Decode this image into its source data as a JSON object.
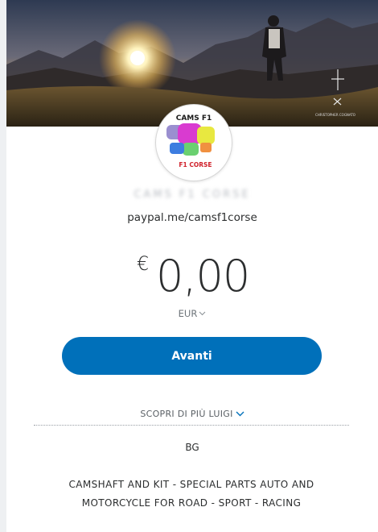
{
  "profile": {
    "logo_text_top": "CAMS F1",
    "logo_text_bottom": "F1 CORSE",
    "name": "CAMS F1 CORSE",
    "handle": "paypal.me/camsf1corse",
    "banner_credit": "CHRISTOPHER COGNATO"
  },
  "payment": {
    "currency_symbol": "€",
    "amount": "0,00",
    "currency_code": "EUR",
    "next_label": "Avanti"
  },
  "details": {
    "more_label": "SCOPRI DI PIÙ LUIGI",
    "code": "BG",
    "description": "CAMSHAFT AND KIT - SPECIAL PARTS AUTO AND MOTORCYCLE FOR ROAD - SPORT - RACING"
  },
  "colors": {
    "primary": "#0070ba",
    "text": "#2c2e2f",
    "muted": "#6c7378"
  },
  "icons": {
    "currency_dropdown": "chevron-down-icon",
    "more_dropdown": "chevron-down-icon"
  }
}
